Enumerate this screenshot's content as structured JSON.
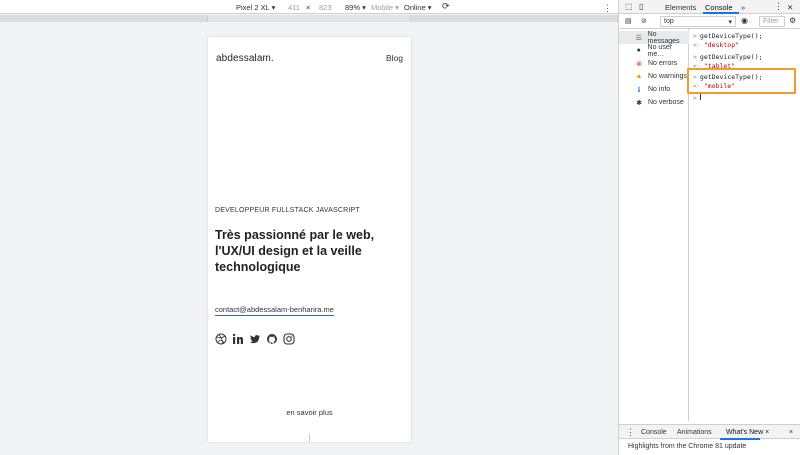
{
  "emulation": {
    "device": "Pixel 2 XL",
    "width": "411",
    "times": "×",
    "height": "823",
    "zoom": "89%",
    "mode": "Mobile",
    "throttle": "Online"
  },
  "page": {
    "logo": "abdessalam",
    "logo_dot": ".",
    "blog_link": "Blog",
    "subtitle": "DEVELOPPEUR FULLSTACK JAVASCRIPT",
    "headline": "Très passionné par le web, l'UX/UI design et la veille technologique",
    "contact": "contact@abdessalam-benharira.me",
    "more": "en savoir plus",
    "social_icons": [
      "dribbble-icon",
      "linkedin-icon",
      "twitter-icon",
      "github-icon",
      "instagram-icon"
    ]
  },
  "devtools": {
    "tabs": [
      "Elements",
      "Console"
    ],
    "more_tabs": "»",
    "context": "top",
    "filter_placeholder": "Filter",
    "sidebar": [
      {
        "icon": "list-icon",
        "label": "No messages"
      },
      {
        "icon": "user-icon",
        "label": "No user me…"
      },
      {
        "icon": "error-icon",
        "label": "No errors"
      },
      {
        "icon": "warning-icon",
        "label": "No warnings"
      },
      {
        "icon": "info-icon",
        "label": "No info"
      },
      {
        "icon": "bug-icon",
        "label": "No verbose"
      }
    ],
    "console": [
      {
        "type": "input",
        "text": "getDeviceType();"
      },
      {
        "type": "output",
        "text": "\"desktop\""
      },
      {
        "type": "input",
        "text": "getDeviceType();"
      },
      {
        "type": "output",
        "text": "\"tablet\""
      },
      {
        "type": "input",
        "text": "getDeviceType();"
      },
      {
        "type": "output",
        "text": "\"mobile\""
      }
    ],
    "drawer_tabs": [
      "Console",
      "Animations",
      "What's New"
    ],
    "drawer_close": "×",
    "drawer_text": "Highlights from the Chrome 81 update"
  },
  "colors": {
    "highlight": "#f29b2b",
    "string": "#c80000",
    "accent": "#1a73e8"
  }
}
